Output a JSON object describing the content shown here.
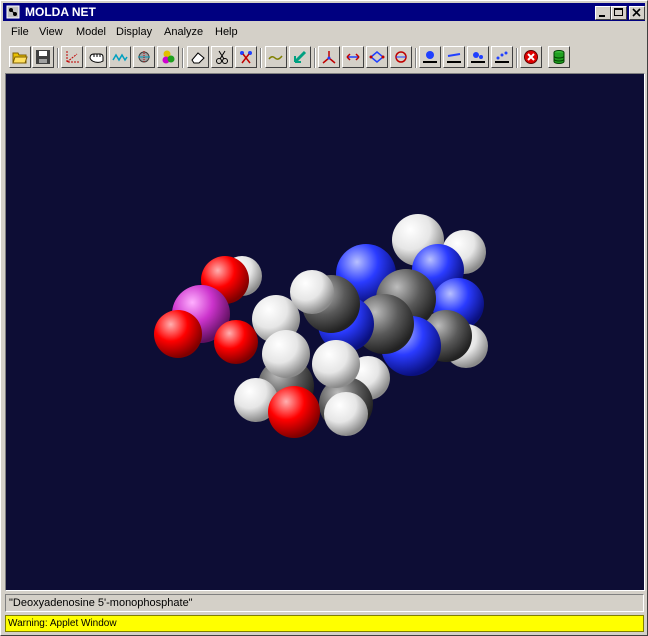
{
  "window": {
    "title": "MOLDA NET"
  },
  "menu": [
    {
      "label": "File"
    },
    {
      "label": "View"
    },
    {
      "label": "Model"
    },
    {
      "label": "Display"
    },
    {
      "label": "Analyze"
    },
    {
      "label": "Help"
    }
  ],
  "toolbar": {
    "tools": [
      {
        "icon": "open-folder-icon"
      },
      {
        "icon": "save-icon"
      },
      {
        "icon": "axes-icon"
      },
      {
        "icon": "hand-icon"
      },
      {
        "icon": "wave-icon"
      },
      {
        "icon": "atom-sphere-icon"
      },
      {
        "icon": "color-spheres-icon"
      },
      {
        "icon": "eraser-icon"
      },
      {
        "icon": "cut-bond-icon"
      },
      {
        "icon": "cut-atoms-icon"
      },
      {
        "icon": "chain-icon"
      },
      {
        "icon": "move-arrow-icon"
      },
      {
        "icon": "measure-angle-icon"
      },
      {
        "icon": "measure-distance-icon"
      },
      {
        "icon": "dihedral-icon"
      },
      {
        "icon": "rotate-icon"
      },
      {
        "icon": "atom-label-icon"
      },
      {
        "icon": "bond-label-icon"
      },
      {
        "icon": "surface-icon"
      },
      {
        "icon": "surface-dots-icon"
      },
      {
        "icon": "stop-icon"
      },
      {
        "icon": "cylinder-icon"
      }
    ]
  },
  "molecule": {
    "name": "\"Deoxyadenosine 5'-monophosphate\""
  },
  "warning": "Warning: Applet Window",
  "colors": {
    "background": "#0d0d35",
    "carbon": "#5a5a5a",
    "hydrogen": "#f0f0f0",
    "nitrogen": "#2a3bff",
    "oxygen": "#ff0000",
    "phosphorus": "#cc33cc"
  }
}
